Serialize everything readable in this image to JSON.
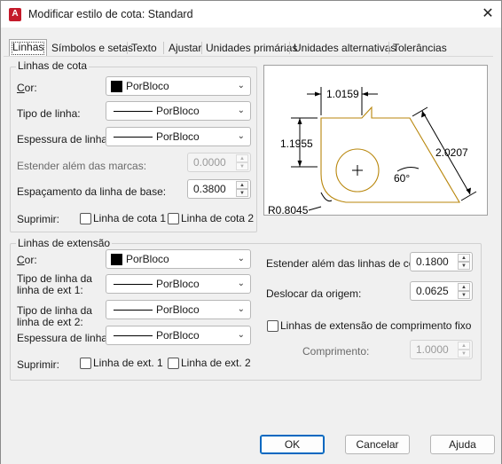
{
  "window": {
    "title": "Modificar estilo de cota: Standard",
    "app_icon_letter": "A",
    "close_glyph": "✕"
  },
  "tabs": [
    {
      "label": "Linhas",
      "active": true
    },
    {
      "label": "Símbolos e setas",
      "active": false
    },
    {
      "label": "Texto",
      "active": false
    },
    {
      "label": "Ajustar",
      "active": false
    },
    {
      "label": "Unidades primárias",
      "active": false
    },
    {
      "label": "Unidades alternativas",
      "active": false
    },
    {
      "label": "Tolerâncias",
      "active": false
    }
  ],
  "dim_lines": {
    "group_label": "Linhas de cota",
    "color_label": "Cor:",
    "color_value": "PorBloco",
    "linetype_label": "Tipo de linha:",
    "linetype_value": "PorBloco",
    "lineweight_label": "Espessura de linha:",
    "lineweight_value": "PorBloco",
    "extend_label": "Estender além das marcas:",
    "extend_value": "0.0000",
    "baseline_label": "Espaçamento da linha de base:",
    "baseline_value": "0.3800",
    "suppress_label": "Suprimir:",
    "suppress_1": "Linha de cota 1",
    "suppress_2": "Linha de cota 2"
  },
  "ext_lines": {
    "group_label": "Linhas de extensão",
    "color_label": "Cor:",
    "color_value": "PorBloco",
    "linetype1_label_a": "Tipo de linha da",
    "linetype1_label_b": "linha de ext 1:",
    "linetype1_value": "PorBloco",
    "linetype2_label_a": "Tipo de linha da",
    "linetype2_label_b": "linha de ext 2:",
    "linetype2_value": "PorBloco",
    "lineweight_label": "Espessura de linha:",
    "lineweight_value": "PorBloco",
    "suppress_label": "Suprimir:",
    "suppress_1": "Linha de ext. 1",
    "suppress_2": "Linha de ext. 2",
    "extend_label": "Estender além das linhas de cota:",
    "extend_value": "0.1800",
    "offset_label": "Deslocar da origem:",
    "offset_value": "0.0625",
    "fixed_label": "Linhas de extensão de comprimento fixo",
    "length_label": "Comprimento:",
    "length_value": "1.0000"
  },
  "preview": {
    "dim_top": "1.0159",
    "dim_left": "1.1955",
    "dim_right": "2.0207",
    "angle": "60°",
    "radius": "R0.8045"
  },
  "buttons": {
    "ok": "OK",
    "cancel": "Cancelar",
    "help": "Ajuda"
  },
  "colors": {
    "accent": "#0067c0",
    "app_icon": "#c41a2a",
    "preview_part": "#b8860b"
  }
}
